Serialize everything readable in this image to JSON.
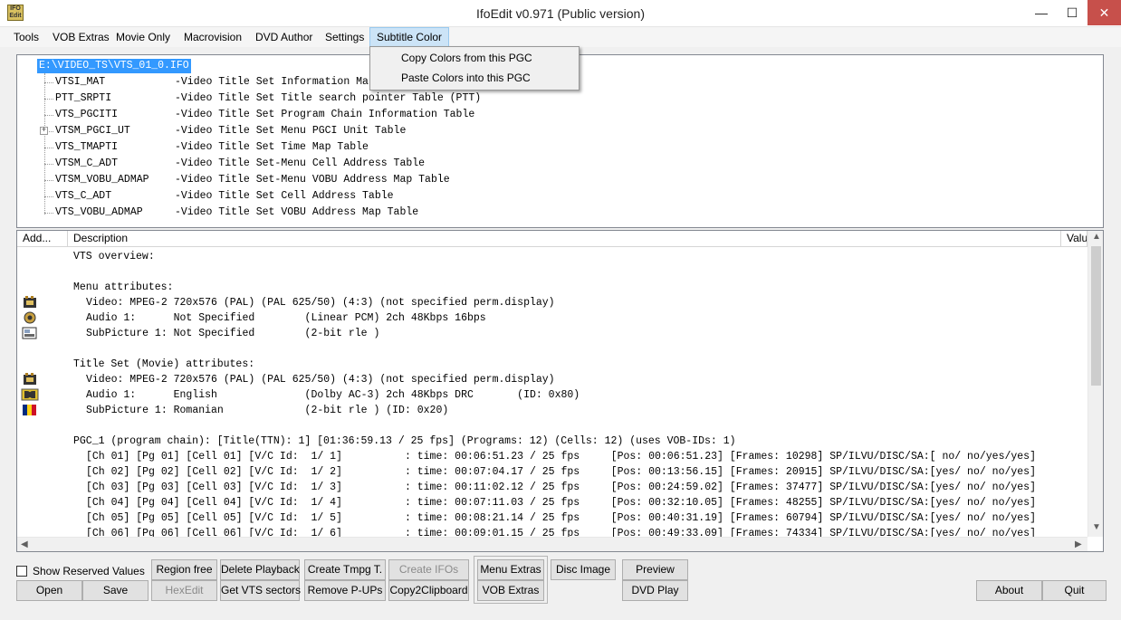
{
  "window": {
    "title": "IfoEdit v0.971 (Public version)",
    "icon_text": "IFO Edit",
    "controls": {
      "minimize": "—",
      "maximize": "☐",
      "close": "✕"
    }
  },
  "menu": {
    "items": [
      "Tools",
      "VOB Extras",
      "Movie Only",
      "Macrovision",
      "DVD Author",
      "Settings",
      "Subtitle Color"
    ],
    "active": "Subtitle Color",
    "dropdown": [
      "Copy Colors from this PGC",
      "Paste Colors into this PGC"
    ]
  },
  "tree": {
    "root": "E:\\VIDEO_TS\\VTS_01_0.IFO",
    "nodes": [
      {
        "name": "VTSI_MAT",
        "desc": "-Video Title Set Information Ma",
        "expandable": false
      },
      {
        "name": "PTT_SRPTI",
        "desc": "-Video Title Set Title search pointer Table (PTT)",
        "expandable": false
      },
      {
        "name": "VTS_PGCITI",
        "desc": "-Video Title Set Program Chain Information Table",
        "expandable": false
      },
      {
        "name": "VTSM_PGCI_UT",
        "desc": "-Video Title Set Menu PGCI Unit Table",
        "expandable": true
      },
      {
        "name": "VTS_TMAPTI",
        "desc": "-Video Title Set Time Map Table",
        "expandable": false
      },
      {
        "name": "VTSM_C_ADT",
        "desc": "-Video Title Set-Menu Cell Address Table",
        "expandable": false
      },
      {
        "name": "VTSM_VOBU_ADMAP",
        "desc": "-Video Title Set-Menu VOBU Address Map Table",
        "expandable": false
      },
      {
        "name": "VTS_C_ADT",
        "desc": "-Video Title Set Cell Address Table",
        "expandable": false
      },
      {
        "name": "VTS_VOBU_ADMAP",
        "desc": "-Video Title Set VOBU Address Map Table",
        "expandable": false
      }
    ]
  },
  "list": {
    "columns": [
      "Add...",
      "Description",
      "Valu"
    ],
    "lines": [
      {
        "text": "VTS overview:",
        "indent": 0,
        "icon": ""
      },
      {
        "text": "",
        "indent": 0,
        "icon": ""
      },
      {
        "text": "Menu attributes:",
        "indent": 0,
        "icon": ""
      },
      {
        "text": "Video: MPEG-2 720x576 (PAL) (PAL 625/50) (4:3) (not specified perm.display)",
        "indent": 1,
        "icon": "film-icon"
      },
      {
        "text": "Audio 1:      Not Specified        (Linear PCM) 2ch 48Kbps 16bps",
        "indent": 1,
        "icon": "speaker-icon"
      },
      {
        "text": "SubPicture 1: Not Specified        (2-bit rle )",
        "indent": 1,
        "icon": "subpicture-icon"
      },
      {
        "text": "",
        "indent": 0,
        "icon": ""
      },
      {
        "text": "Title Set (Movie) attributes:",
        "indent": 0,
        "icon": ""
      },
      {
        "text": "Video: MPEG-2 720x576 (PAL) (PAL 625/50) (4:3) (not specified perm.display)",
        "indent": 1,
        "icon": "film-icon"
      },
      {
        "text": "Audio 1:      English              (Dolby AC-3) 2ch 48Kbps DRC       (ID: 0x80)",
        "indent": 1,
        "icon": "dolby-icon"
      },
      {
        "text": "SubPicture 1: Romanian             (2-bit rle ) (ID: 0x20)",
        "indent": 1,
        "icon": "romania-flag-icon"
      },
      {
        "text": "",
        "indent": 0,
        "icon": ""
      },
      {
        "text": "PGC_1 (program chain): [Title(TTN): 1] [01:36:59.13 / 25 fps] (Programs: 12) (Cells: 12) (uses VOB-IDs: 1)",
        "indent": 0,
        "icon": ""
      },
      {
        "text": "[Ch 01] [Pg 01] [Cell 01] [V/C Id:  1/ 1]          : time: 00:06:51.23 / 25 fps     [Pos: 00:06:51.23] [Frames: 10298] SP/ILVU/DISC/SA:[ no/ no/yes/yes]",
        "indent": 1,
        "icon": ""
      },
      {
        "text": "[Ch 02] [Pg 02] [Cell 02] [V/C Id:  1/ 2]          : time: 00:07:04.17 / 25 fps     [Pos: 00:13:56.15] [Frames: 20915] SP/ILVU/DISC/SA:[yes/ no/ no/yes]",
        "indent": 1,
        "icon": ""
      },
      {
        "text": "[Ch 03] [Pg 03] [Cell 03] [V/C Id:  1/ 3]          : time: 00:11:02.12 / 25 fps     [Pos: 00:24:59.02] [Frames: 37477] SP/ILVU/DISC/SA:[yes/ no/ no/yes]",
        "indent": 1,
        "icon": ""
      },
      {
        "text": "[Ch 04] [Pg 04] [Cell 04] [V/C Id:  1/ 4]          : time: 00:07:11.03 / 25 fps     [Pos: 00:32:10.05] [Frames: 48255] SP/ILVU/DISC/SA:[yes/ no/ no/yes]",
        "indent": 1,
        "icon": ""
      },
      {
        "text": "[Ch 05] [Pg 05] [Cell 05] [V/C Id:  1/ 5]          : time: 00:08:21.14 / 25 fps     [Pos: 00:40:31.19] [Frames: 60794] SP/ILVU/DISC/SA:[yes/ no/ no/yes]",
        "indent": 1,
        "icon": ""
      },
      {
        "text": "[Ch 06] [Pg 06] [Cell 06] [V/C Id:  1/ 6]          : time: 00:09:01.15 / 25 fps     [Pos: 00:49:33.09] [Frames: 74334] SP/ILVU/DISC/SA:[yes/ no/ no/yes]",
        "indent": 1,
        "icon": ""
      }
    ]
  },
  "controls": {
    "show_reserved": {
      "label": "Show Reserved Values",
      "checked": false
    },
    "buttons": {
      "region_free": "Region free",
      "delete_playback": "Delete Playback",
      "create_tmpg": "Create Tmpg T.",
      "create_ifos": "Create IFOs",
      "menu_extras": "Menu Extras",
      "disc_image": "Disc Image",
      "preview": "Preview",
      "open": "Open",
      "save": "Save",
      "hexedit": "HexEdit",
      "get_vts_sectors": "Get VTS sectors",
      "remove_pups": "Remove P-UPs",
      "copy2clipboard": "Copy2Clipboard",
      "vob_extras": "VOB Extras",
      "dvd_play": "DVD Play",
      "about": "About",
      "quit": "Quit"
    },
    "disabled": [
      "create_ifos",
      "hexedit"
    ]
  },
  "colors": {
    "selection": "#3399ff",
    "menu_highlight": "#cce4f7",
    "close_button": "#c7504b"
  }
}
